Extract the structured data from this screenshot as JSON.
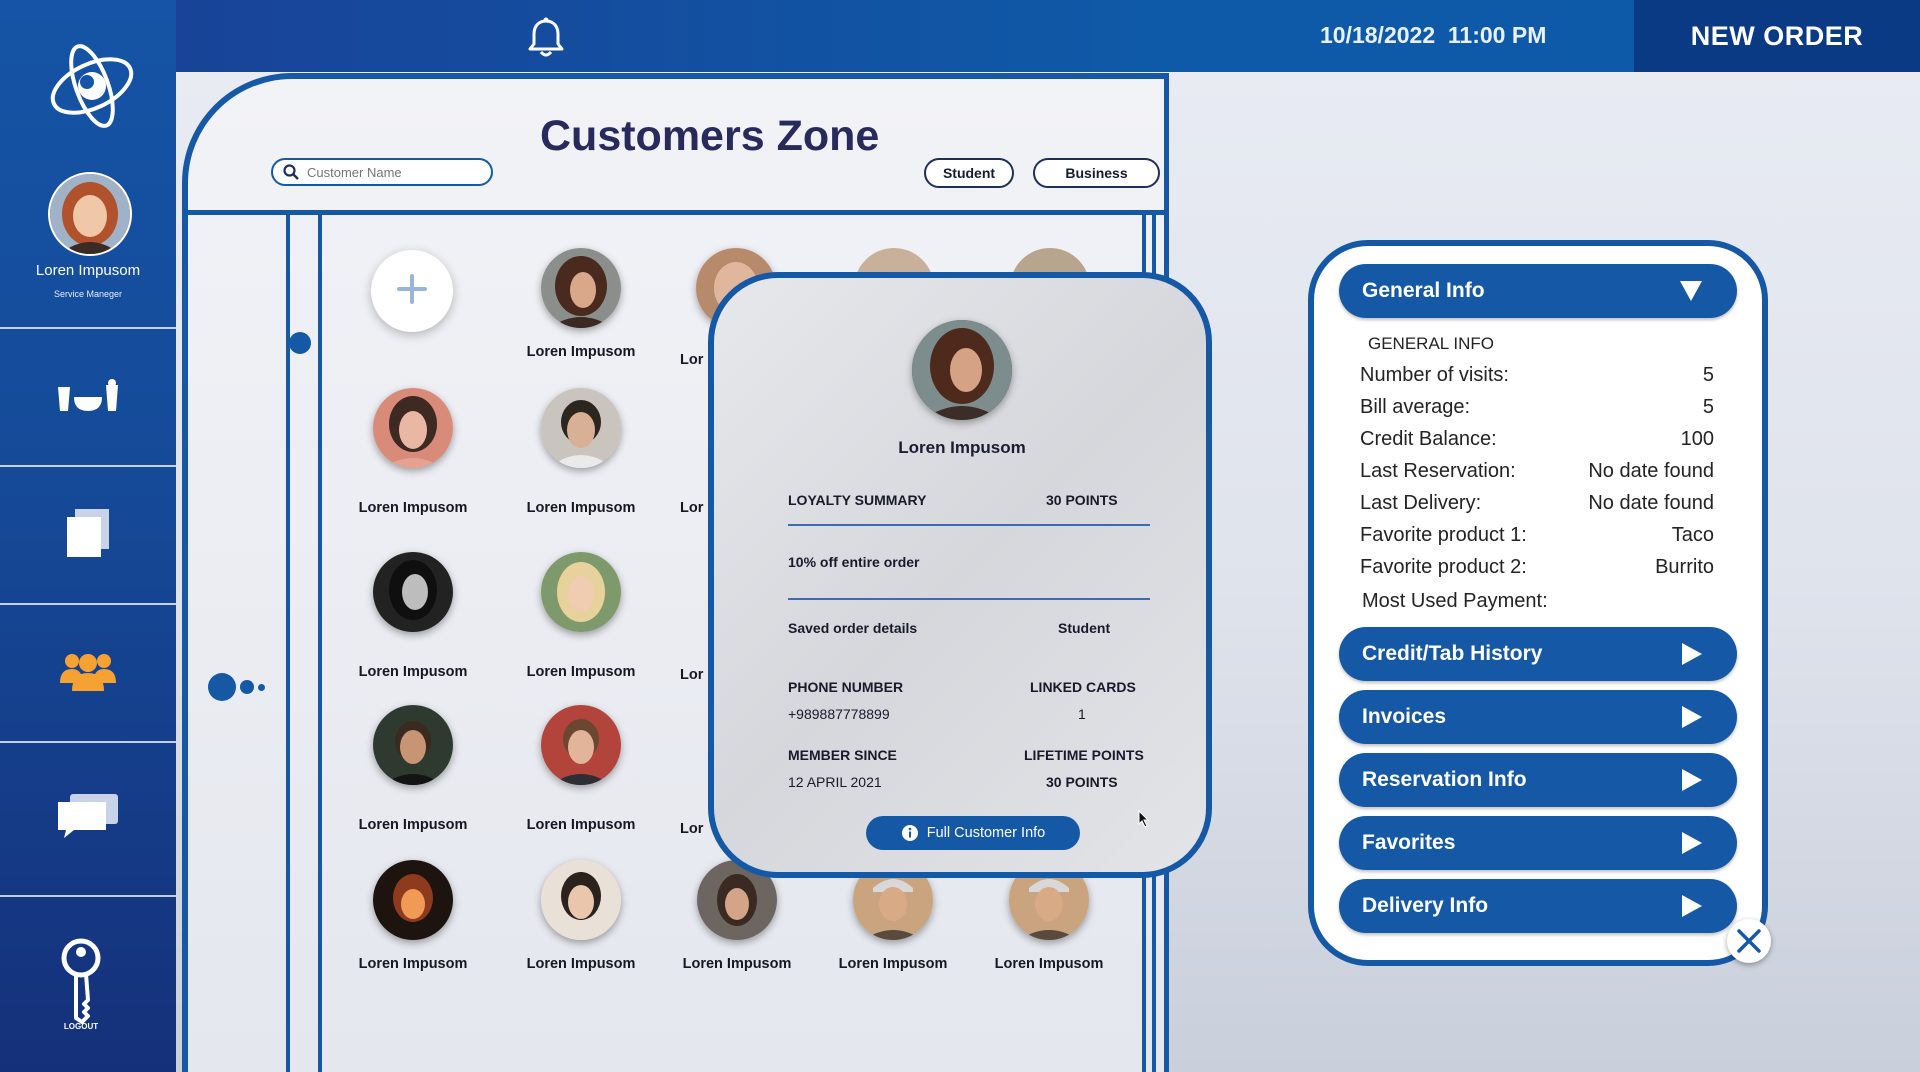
{
  "header": {
    "date": "10/18/2022",
    "time": "11:00 PM",
    "new_order_label": "NEW ORDER"
  },
  "sidebar": {
    "user_name": "Loren Impusom",
    "user_role": "Service Manеger",
    "logout_label": "LOGOUT",
    "items": [
      {
        "icon": "food-drinks-icon"
      },
      {
        "icon": "documents-icon"
      },
      {
        "icon": "customers-icon",
        "color": "#f5a233"
      },
      {
        "icon": "chat-icon"
      }
    ]
  },
  "main": {
    "title": "Customers Zone",
    "search": {
      "placeholder": "Customer Name",
      "value": ""
    },
    "filters": {
      "student": "Student",
      "business": "Business"
    },
    "add_icon": "plus-icon",
    "customer_name": "Loren Impusom"
  },
  "card": {
    "name": "Loren Impusom",
    "loyalty_label": "LOYALTY SUMMARY",
    "loyalty_value": "30 POINTS",
    "offer": "10% off entire order",
    "saved_label": "Saved order details",
    "saved_value": "Student",
    "phone_label": "PHONE NUMBER",
    "phone_value": "+989887778899",
    "cards_label": "LINKED CARDS",
    "cards_value": "1",
    "member_label": "MEMBER SINCE",
    "member_value": "12 APRIL 2021",
    "lifetime_label": "LIFETIME POINTS",
    "lifetime_value": "30 POINTS",
    "button_label": "Full Customer Info"
  },
  "info_panel": {
    "general_info_label": "General Info",
    "heading": "GENERAL INFO",
    "rows": [
      {
        "label": "Number of visits:",
        "value": "5"
      },
      {
        "label": "Bill average:",
        "value": "5"
      },
      {
        "label": "Credit Balance:",
        "value": "100"
      },
      {
        "label": "Last Reservation:",
        "value": "No date found"
      },
      {
        "label": "Last Delivery:",
        "value": "No date found"
      },
      {
        "label": "Favorite product 1:",
        "value": "Taco"
      },
      {
        "label": "Favorite product 2:",
        "value": "Burrito"
      },
      {
        "label": "Most Used Payment:",
        "value": ""
      }
    ],
    "sections": [
      "Credit/Tab History",
      "Invoices",
      "Reservation Info",
      "Favorites",
      "Delivery Info"
    ]
  },
  "colors": {
    "primary": "#1559a6",
    "title": "#282a5c",
    "sidebar_top": "#1554a6",
    "sidebar_bottom": "#15307a",
    "accent": "#f5a233"
  }
}
